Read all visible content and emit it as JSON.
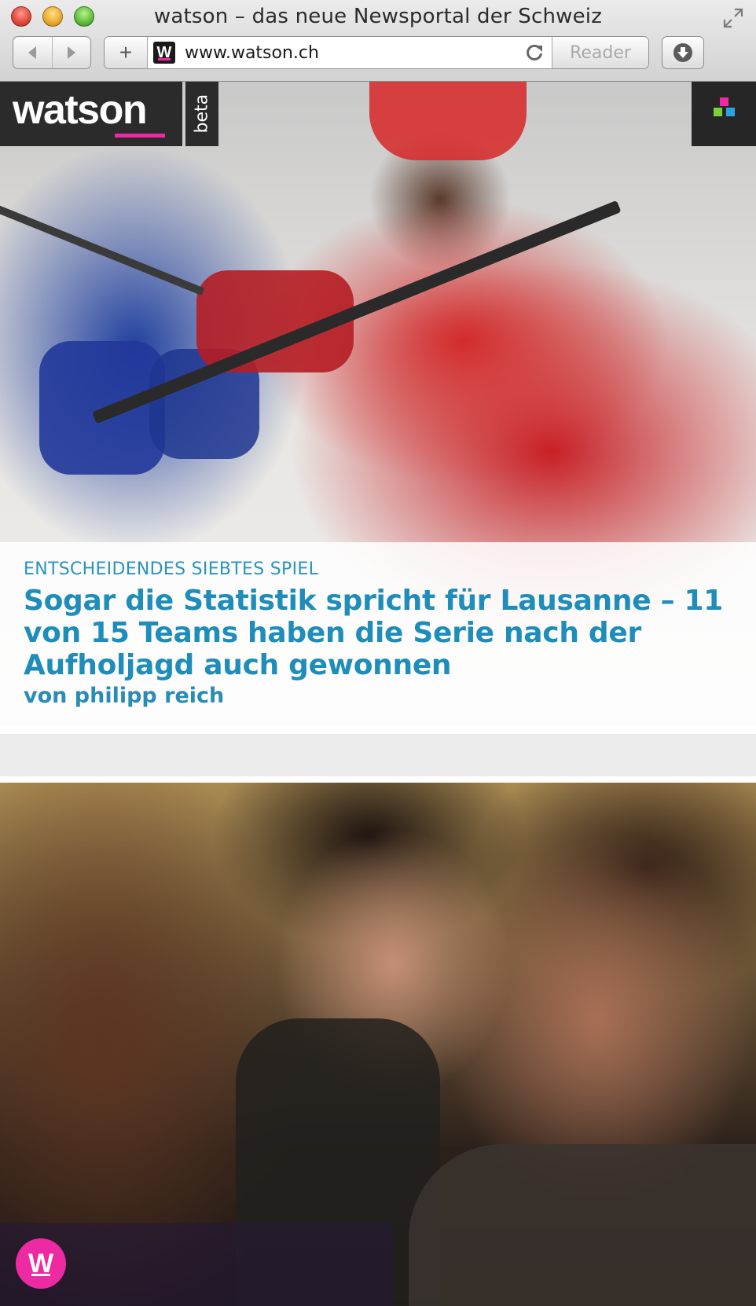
{
  "browser": {
    "window_title": "watson – das neue Newsportal der Schweiz",
    "url": "www.watson.ch",
    "reader_label": "Reader",
    "favicon_letter": "W",
    "add_label": "+",
    "back_icon": "chevron-left-icon",
    "forward_icon": "chevron-right-icon",
    "download_icon": "download-icon"
  },
  "site": {
    "logo": "watson",
    "beta_label": "beta",
    "brand_color": "#ee2aa3",
    "menu_icon": "squares-menu-icon",
    "menu_colors": [
      "#ee2aa3",
      "#7ad13a",
      "#2aa4e0",
      "#2aa4e0"
    ]
  },
  "teaser": {
    "kicker": "ENTSCHEIDENDES SIEBTES SPIEL",
    "headline": "Sogar die Statistik spricht für Lausanne – 11 von 15 Teams haben die Serie nach der Aufholjagd auch gewonnen",
    "byline": "von philipp reich",
    "accent_color": "#1e8db9"
  },
  "badge": {
    "letter": "W"
  }
}
